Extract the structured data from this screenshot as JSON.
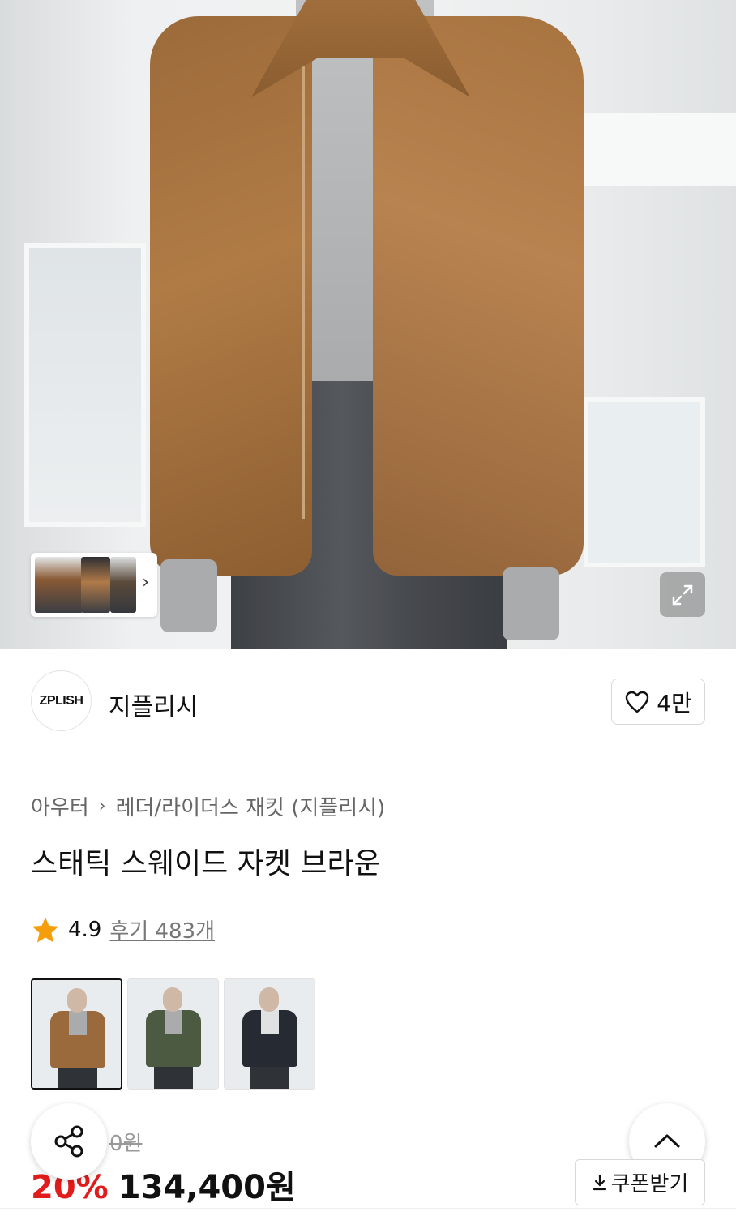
{
  "hero": {
    "image_alt": "product-photo-brown-suede-jacket",
    "thumb_more_icon": "chevron-right-icon",
    "expand_icon": "expand-icon"
  },
  "brand": {
    "logo_text": "ZPLISH",
    "name": "지플리시",
    "like_icon": "heart-icon",
    "like_count": "4만"
  },
  "breadcrumb": {
    "category": "아우터",
    "subcategory": "레더/라이더스 재킷 (지플리시)"
  },
  "product": {
    "title": "스태틱 스웨이드 자켓 브라운",
    "rating": "4.9",
    "reviews_label": "후기 483개",
    "colors": [
      {
        "name": "brown",
        "hex": "#9a6a3c",
        "selected": true
      },
      {
        "name": "khaki",
        "hex": "#4b5a40",
        "selected": false
      },
      {
        "name": "navy",
        "hex": "#262a33",
        "selected": false
      }
    ]
  },
  "price": {
    "original": "0원",
    "discount": "20%",
    "final": "134,400원"
  },
  "actions": {
    "share_icon": "share-icon",
    "top_icon": "chevron-up-icon",
    "coupon_label": "쿠폰받기",
    "coupon_icon": "download-icon"
  },
  "colors": {
    "discount_red": "#e01c1c",
    "star_orange": "#f59e0b"
  }
}
